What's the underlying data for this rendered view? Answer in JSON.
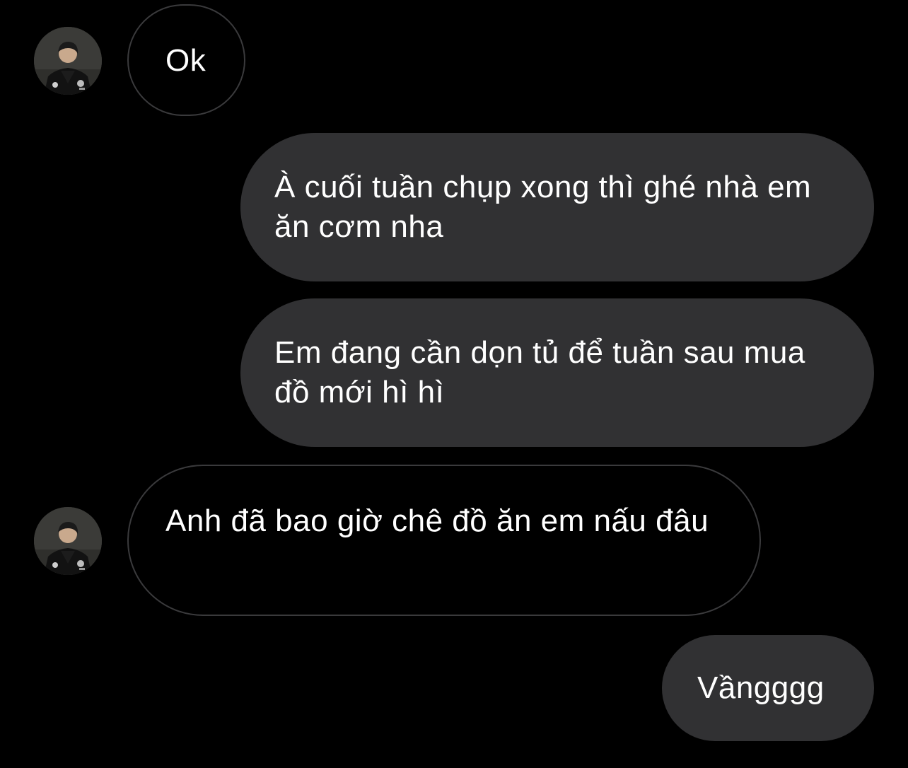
{
  "conversation": {
    "messages": [
      {
        "direction": "incoming",
        "text": "Ok"
      },
      {
        "direction": "outgoing",
        "text": "À cuối tuần chụp xong thì ghé nhà em ăn cơm nha"
      },
      {
        "direction": "outgoing",
        "text": "Em đang cần dọn tủ để tuần sau mua đồ mới hì hì"
      },
      {
        "direction": "incoming",
        "text": "Anh đã bao giờ chê đồ ăn em nấu đâu"
      },
      {
        "direction": "outgoing",
        "text": "Vầngggg"
      }
    ]
  },
  "icons": {
    "contact_avatar": "contact-avatar-photo"
  },
  "colors": {
    "background": "#000000",
    "outgoing_bubble": "#313133",
    "incoming_border": "#3a3a3c",
    "text": "#ffffff"
  }
}
